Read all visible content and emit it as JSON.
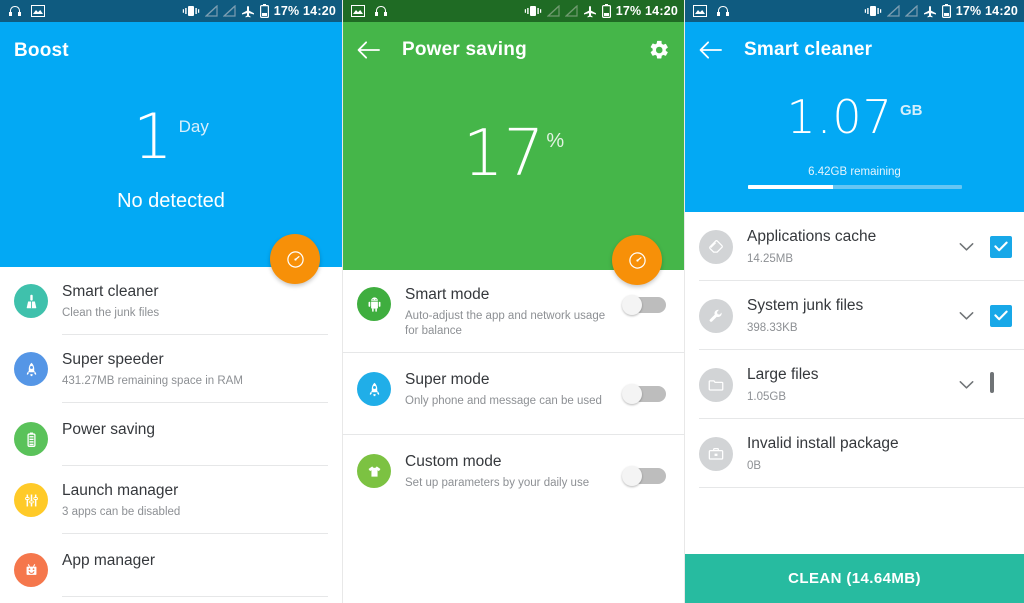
{
  "statusbar": {
    "battery_time": "17% 14:20",
    "icons": [
      "headphones-icon",
      "image-icon",
      "vibrate-icon",
      "signal-off-icon",
      "signal-off-icon",
      "airplane-icon",
      "battery-icon"
    ]
  },
  "screen1": {
    "title": "Boost",
    "hero": {
      "number": "1",
      "unit": "Day",
      "subtitle": "No detected"
    },
    "fab_icon": "gauge-icon",
    "items": [
      {
        "title": "Smart cleaner",
        "subtitle": "Clean the junk files",
        "icon": "broom-icon",
        "color": "#3fc1ac"
      },
      {
        "title": "Super speeder",
        "subtitle": "431.27MB remaining space in RAM",
        "icon": "rocket-icon",
        "color": "#5596e6"
      },
      {
        "title": "Power saving",
        "subtitle": "",
        "icon": "battery-icon",
        "color": "#5ac champion"
      },
      {
        "title": "Launch manager",
        "subtitle": "3 apps can be disabled",
        "icon": "sliders-icon",
        "color": "#ffca28"
      },
      {
        "title": "App manager",
        "subtitle": "",
        "icon": "android-icon",
        "color": "#f5774c"
      }
    ]
  },
  "screen2": {
    "title": "Power saving",
    "back_icon": "back-arrow-icon",
    "settings_icon": "gear-icon",
    "hero": {
      "number": "17",
      "unit": "%"
    },
    "fab_icon": "gauge-icon",
    "items": [
      {
        "title": "Smart mode",
        "subtitle": "Auto-adjust the app and network usage for balance",
        "icon": "android-icon",
        "color": "#3fae3f",
        "on": false
      },
      {
        "title": "Super mode",
        "subtitle": "Only phone and message can be used",
        "icon": "rocket-icon",
        "color": "#20aee8",
        "on": false
      },
      {
        "title": "Custom mode",
        "subtitle": "Set up parameters by your daily use",
        "icon": "shirt-icon",
        "color": "#7cc242",
        "on": false
      }
    ]
  },
  "screen3": {
    "title": "Smart cleaner",
    "back_icon": "back-arrow-icon",
    "hero": {
      "number": "1.07",
      "unit": "GB",
      "remaining": "6.42GB remaining",
      "progress_percent": 40
    },
    "items": [
      {
        "title": "Applications cache",
        "size": "14.25MB",
        "icon": "eraser-icon",
        "checked": true,
        "expandable": true
      },
      {
        "title": "System junk files",
        "size": "398.33KB",
        "icon": "wrench-icon",
        "checked": true,
        "expandable": true
      },
      {
        "title": "Large files",
        "size": "1.05GB",
        "icon": "folder-icon",
        "checked": false,
        "expandable": true
      },
      {
        "title": "Invalid install package",
        "size": "0B",
        "icon": "briefcase-icon",
        "checked": null,
        "expandable": false
      }
    ],
    "clean_button": "CLEAN (14.64MB)"
  },
  "colors": {
    "blue": "#03a9f4",
    "green": "#45b649",
    "orange": "#f79008",
    "teal": "#27bba0"
  }
}
